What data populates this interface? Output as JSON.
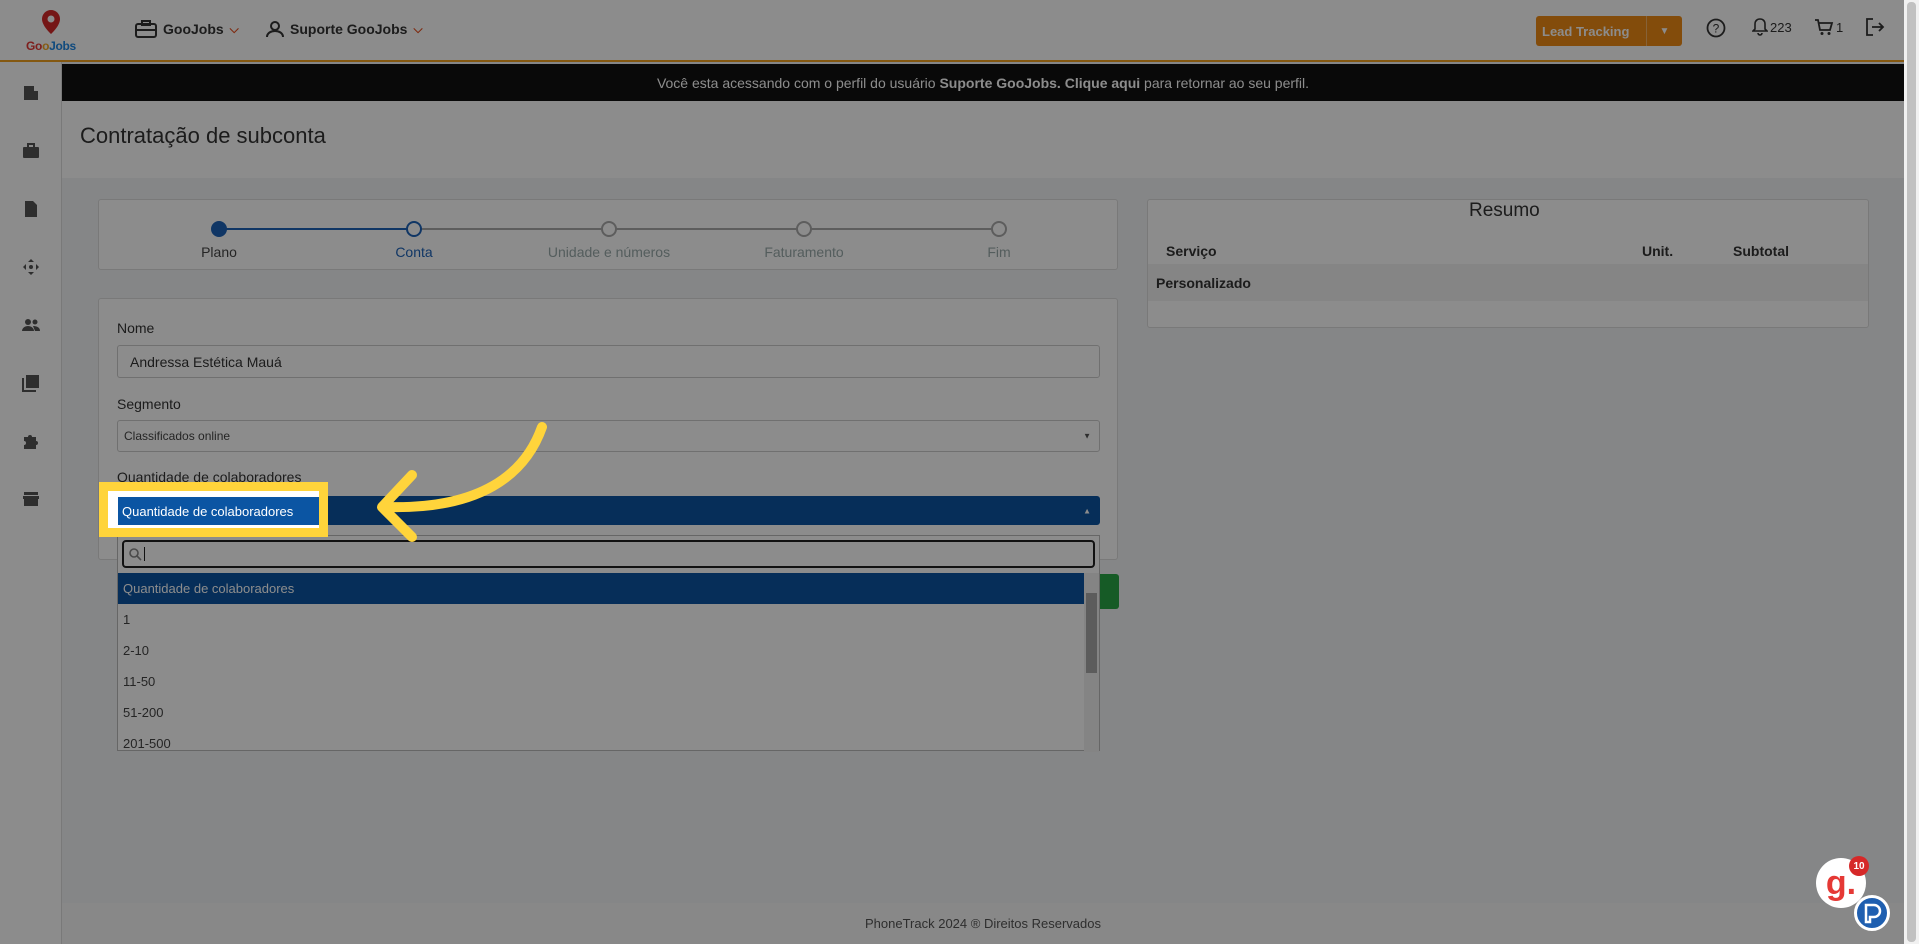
{
  "navbar": {
    "logo_text": "GooJobs",
    "menu_company": "GooJobs",
    "menu_user": "Suporte GooJobs",
    "lead_button": "Lead Tracking",
    "notifications_count": "223",
    "cart_count": "1"
  },
  "banner": {
    "prefix": "Você esta acessando com o perfil do usuário",
    "user": "Suporte GooJobs.",
    "link": "Clique aqui",
    "suffix": "para retornar ao seu perfil."
  },
  "page": {
    "title": "Contratação de subconta"
  },
  "stepper": {
    "steps": [
      {
        "label": "Plano"
      },
      {
        "label": "Conta"
      },
      {
        "label": "Unidade e números"
      },
      {
        "label": "Faturamento"
      },
      {
        "label": "Fim"
      }
    ]
  },
  "form": {
    "name_label": "Nome",
    "name_value": "Andressa Estética Mauá",
    "segment_label": "Segmento",
    "segment_value": "Classificados online",
    "employees_label": "Quantidade de colaboradores",
    "employees_value": "Quantidade de colaboradores",
    "employee_options": [
      "Quantidade de colaboradores",
      "1",
      "2-10",
      "11-50",
      "51-200",
      "201-500"
    ]
  },
  "summary": {
    "title": "Resumo",
    "col_service": "Serviço",
    "col_unit": "Unit.",
    "col_subtotal": "Subtotal",
    "row_plan": "Personalizado"
  },
  "footer": {
    "text": "PhoneTrack 2024 ® Direitos Reservados"
  },
  "widgets": {
    "help_letter": "g.",
    "help_badge": "10"
  },
  "colors": {
    "accent": "#ef8a14",
    "primary": "#0b55a3",
    "highlight": "#ffd43b",
    "success": "#28a745"
  }
}
